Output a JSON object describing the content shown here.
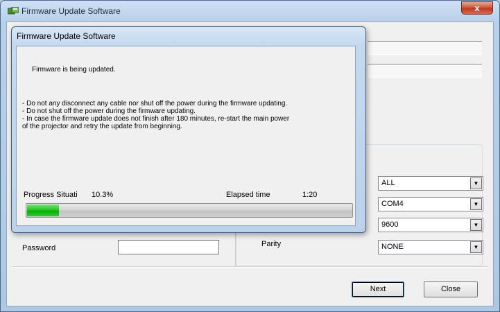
{
  "window": {
    "title": "Firmware Update Software",
    "close_label": "x"
  },
  "form": {
    "password_label": "Password",
    "password_value": "",
    "parity_label": "Parity",
    "combos": [
      {
        "value": "ALL"
      },
      {
        "value": "COM4"
      },
      {
        "value": "9600"
      },
      {
        "value": "NONE"
      }
    ],
    "next_label": "Next",
    "close_label": "Close"
  },
  "dialog": {
    "title": "Firmware Update Software",
    "message": "Firmware is being updated.",
    "bullets": [
      "- Do not any disconnect any cable nor shut off the power during the firmware updating.",
      "- Do not shut off the power during the firmware updating.",
      "- In case the firmware update does not finish after 180 minutes, re-start the main power",
      "of the projector and retry the update from beginning."
    ],
    "progress_label": "Progress Situati",
    "progress_text": "10.3%",
    "progress_fraction": 0.103,
    "elapsed_label": "Elapsed time",
    "elapsed_value": "1:20"
  },
  "colors": {
    "progress_fill": "#1fbf1f",
    "title_bar": "#c4d8ee",
    "close_button": "#c9432a"
  },
  "icons": {
    "app": "firmware-app-icon",
    "dropdown": "chevron-down-icon"
  }
}
